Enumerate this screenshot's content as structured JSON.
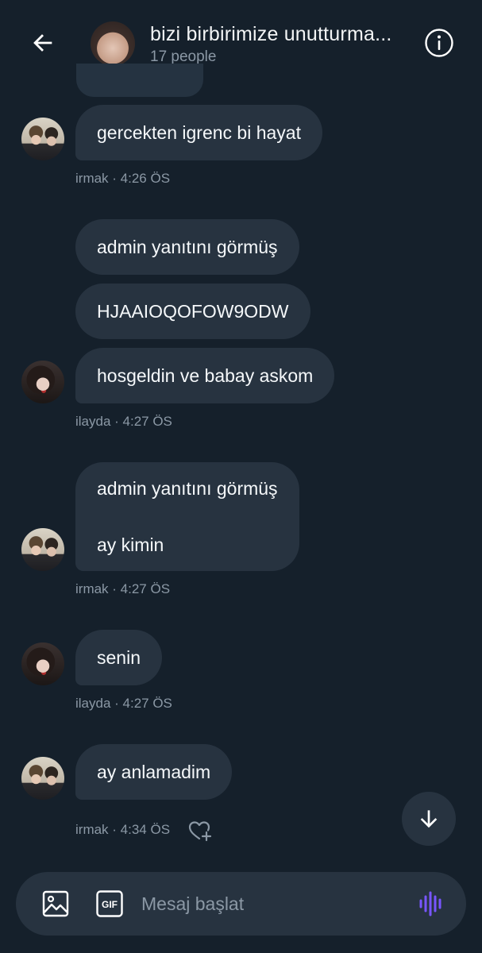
{
  "header": {
    "title": "bizi birbirimize unutturma...",
    "subtitle": "17 people"
  },
  "messages": [
    {
      "text": "gercekten igrenc bi hayat",
      "meta": "irmak · 4:26 ÖS"
    },
    {
      "text": "admin yanıtını görmüş"
    },
    {
      "text": "HJAAIOQOFOW9ODW"
    },
    {
      "text": "hosgeldin ve babay askom",
      "meta": "ilayda · 4:27 ÖS"
    },
    {
      "line1": "admin yanıtını görmüş",
      "line2": "ay kimin",
      "meta": "irmak · 4:27 ÖS"
    },
    {
      "text": "senin",
      "meta": "ilayda · 4:27 ÖS"
    },
    {
      "text": "ay anlamadim",
      "meta": "irmak · 4:34 ÖS"
    }
  ],
  "composer": {
    "placeholder": "Mesaj başlat",
    "gif_label": "GIF"
  },
  "icons": {
    "back": "arrow-left-icon",
    "info": "info-icon",
    "heart_add": "heart-plus-icon",
    "scroll_down": "arrow-down-icon",
    "image": "image-icon",
    "gif": "gif-icon",
    "voice": "voice-waveform-icon"
  },
  "colors": {
    "background": "#15202b",
    "bubble": "#273340",
    "meta_text": "#8b98a5",
    "voice_accent": "#7856ff"
  }
}
